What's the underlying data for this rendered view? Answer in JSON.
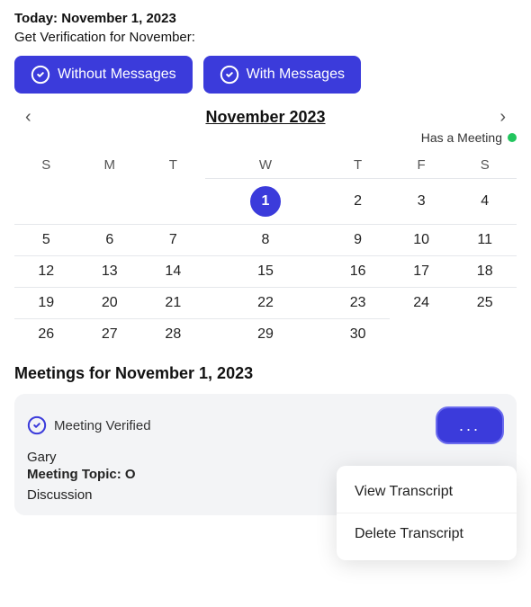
{
  "header": {
    "today_prefix": "Today: ",
    "today_date": "November 1, 2023",
    "verify_label": "Get Verification for November:"
  },
  "buttons": {
    "without_messages": "Without Messages",
    "with_messages": "With Messages"
  },
  "calendar": {
    "month_title": "November 2023",
    "has_meeting_label": "Has a Meeting",
    "weekdays": [
      "S",
      "M",
      "T",
      "W",
      "T",
      "F",
      "S"
    ],
    "weeks": [
      [
        null,
        null,
        null,
        1,
        2,
        3,
        4
      ],
      [
        5,
        6,
        7,
        8,
        9,
        10,
        11
      ],
      [
        12,
        13,
        14,
        15,
        16,
        17,
        18
      ],
      [
        19,
        20,
        21,
        22,
        23,
        24,
        25
      ],
      [
        26,
        27,
        28,
        29,
        30,
        null,
        null
      ]
    ],
    "today_day": 1
  },
  "meetings": {
    "title": "Meetings for November 1, 2023",
    "card": {
      "verified_label": "Meeting Verified",
      "name": "Gary",
      "topic_prefix": "Meeting Topic: ",
      "topic": "O",
      "subtopic": "Discussion",
      "dots": "..."
    },
    "dropdown": {
      "items": [
        "View Transcript",
        "Delete Transcript"
      ]
    }
  }
}
